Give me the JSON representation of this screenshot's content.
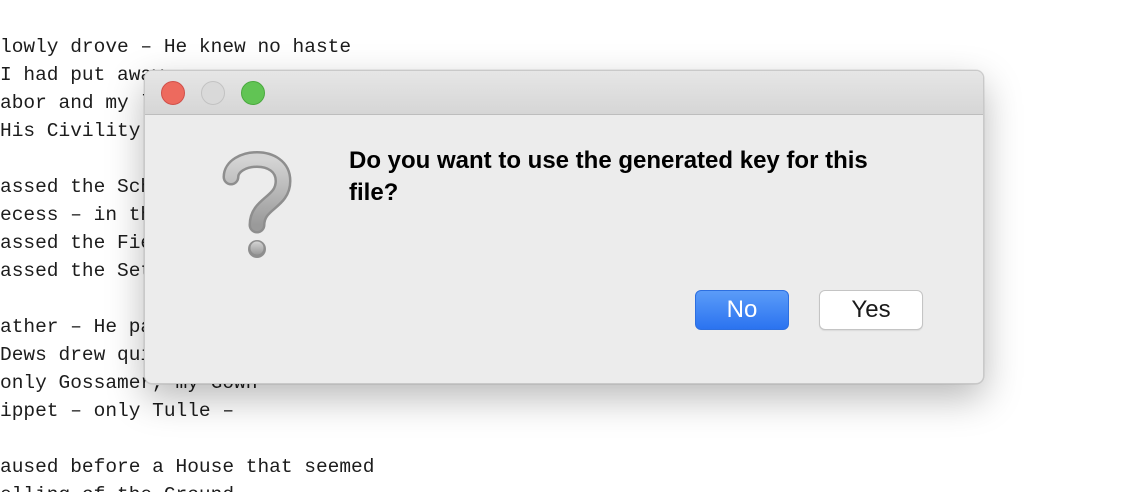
{
  "background_text": {
    "lines": [
      "lowly drove – He knew no haste",
      "I had put away",
      "abor and my l",
      "His Civility",
      "",
      "assed the Sch",
      "ecess – in th",
      "assed the Fie",
      "assed the Set",
      "",
      "ather – He pa",
      "Dews drew qui",
      "only Gossamer, my Gown –",
      "ippet – only Tulle –",
      "",
      "aused before a House that seemed",
      "elling of the Ground"
    ]
  },
  "dialog": {
    "message": "Do you want to use the generated key for this file?",
    "icon": "question-mark-icon",
    "buttons": {
      "no_label": "No",
      "yes_label": "Yes"
    }
  },
  "colors": {
    "close_button": "#ed6a5e",
    "minimize_button": "#d9d9d9",
    "zoom_button": "#61c454",
    "primary_button": "#2b73f0"
  }
}
